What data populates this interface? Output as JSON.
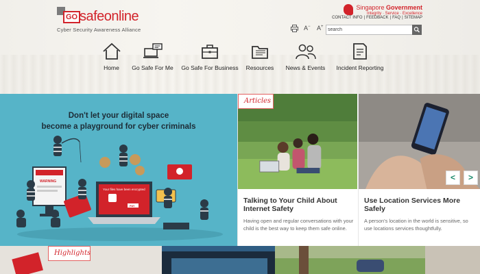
{
  "logo": {
    "go": "GO",
    "word": "safeonline",
    "tagline": "Cyber Security Awareness Alliance"
  },
  "gov": {
    "name_a": "Singapore ",
    "name_b": "Government",
    "tagline": "Integrity · Service · Excellence"
  },
  "toplinks": [
    "CONTACT INFO",
    "FEEDBACK",
    "FAQ",
    "SITEMAP"
  ],
  "tools": {
    "print": "print-icon",
    "font_small": "A",
    "font_large": "A"
  },
  "search": {
    "value": "search"
  },
  "nav": [
    {
      "label": "Home",
      "icon": "home-icon"
    },
    {
      "label": "Go Safe For Me",
      "icon": "laptop-chat-icon"
    },
    {
      "label": "Go Safe For Business",
      "icon": "briefcase-icon"
    },
    {
      "label": "Resources",
      "icon": "folder-icon"
    },
    {
      "label": "News & Events",
      "icon": "people-icon"
    },
    {
      "label": "Incident Reporting",
      "icon": "report-icon"
    }
  ],
  "hero": {
    "line1": "Don't let your digital space",
    "line2": "become a playground for cyber criminals",
    "screen_text": "Your files have been encrypted",
    "warning": "WARNING",
    "pay": "PAY"
  },
  "articles_label": "Articles",
  "articles": [
    {
      "title": "Talking to Your Child About Internet Safety",
      "body": "Having open and regular conversations with your child is the best way to keep them safe online."
    },
    {
      "title": "Use Location Services More Safely",
      "body": "A person's location in the world is sensitive, so use locations services thoughtfully."
    }
  ],
  "arrows": {
    "prev": "<",
    "next": ">"
  },
  "highlights_label": "Highlights",
  "colors": {
    "brand_red": "#d2232a",
    "hero_blue": "#56b4c8",
    "arrow_green": "#1a8a6b"
  }
}
